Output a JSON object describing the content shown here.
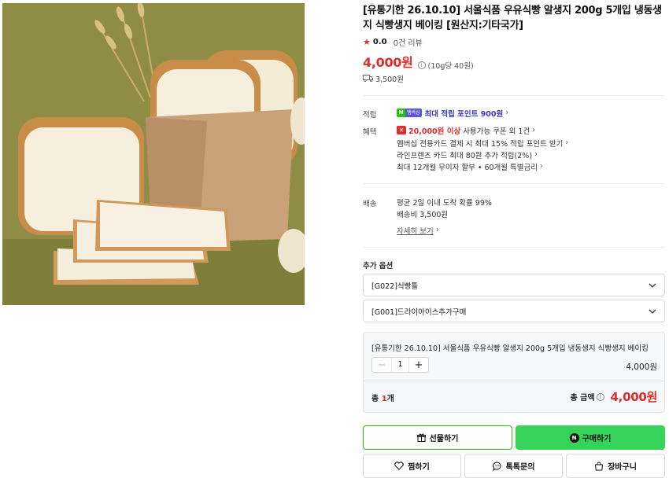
{
  "product": {
    "title": "[유통기한 26.10.10] 서울식품 우유식빵 알생지 200g 5개입 냉동생지 식빵생지 베이킹 [원산지:기타국가]",
    "rating": "0.0",
    "review_count": "0건 리뷰",
    "price": "4,000원",
    "unit_price": "(10g당 40원)",
    "shipping_fee": "3,500원"
  },
  "benefits": {
    "points_label": "적립",
    "npay_badge_n": "N",
    "npay_badge_member": "멤버십",
    "points_text": "최대 적립 포인트 900원",
    "benefits_label": "혜택",
    "coupon_badge": "⌘",
    "coupon_strong": "20,000원 이상",
    "coupon_rest": "사용가능 쿠폰 외 1건",
    "line2": "멤버십 전용카드 결제 시 최대 15% 적립 포인트 받기",
    "line3": "라인프렌즈 카드 최대 80원 추가 적립(2%)",
    "line4": "최대 12개월 무이자 할부 • 60개월 특별금리"
  },
  "delivery": {
    "label": "배송",
    "line1": "평균 2일 이내 도착 확률 99%",
    "line2": "배송비 3,500원",
    "details_link": "자세히 보기"
  },
  "options": {
    "section_label": "추가 옵션",
    "select1": "[G022]식빵틀",
    "select2": "[G001]드라이아이스추가구매"
  },
  "selected": {
    "name": "[유통기한 26.10.10] 서울식품 우유식빵 알생지 200g 5개입 냉동생지 식빵생지 베이킹",
    "minus": "−",
    "quantity": "1",
    "plus": "+",
    "line_price": "4,000원",
    "total_count_prefix": "총 ",
    "total_count_num": "1",
    "total_count_suffix": "개",
    "total_label": "총 금액",
    "total_amount": "4,000원"
  },
  "buttons": {
    "gift": "선물하기",
    "buy": "구매하기",
    "buy_icon": "N",
    "wishlist": "찜하기",
    "talk": "톡톡문의",
    "cart": "장바구니"
  },
  "colors": {
    "price_red": "#e02c2c",
    "naver_green": "#1ec800",
    "buy_green": "#35d35a",
    "membership_blue": "#3b38c8"
  }
}
